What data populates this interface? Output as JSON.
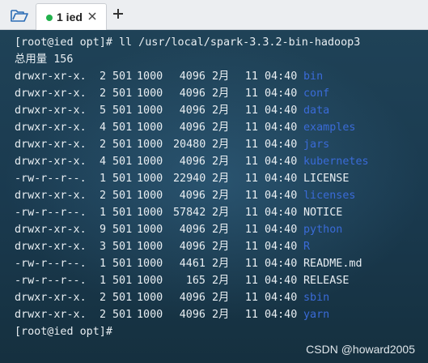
{
  "tabs": [
    {
      "label": "1 ied",
      "active": true,
      "status_color": "#22b14c"
    }
  ],
  "terminal": {
    "prompt_command": "[root@ied opt]# ll /usr/local/spark-3.3.2-bin-hadoop3",
    "total_line": "总用量 156",
    "entries": [
      {
        "perm": "drwxr-xr-x.",
        "links": "2",
        "user": "501",
        "group": "1000",
        "size": "4096",
        "month": "2月",
        "day": "11",
        "time": "04:40",
        "name": "bin",
        "dir": true
      },
      {
        "perm": "drwxr-xr-x.",
        "links": "2",
        "user": "501",
        "group": "1000",
        "size": "4096",
        "month": "2月",
        "day": "11",
        "time": "04:40",
        "name": "conf",
        "dir": true
      },
      {
        "perm": "drwxr-xr-x.",
        "links": "5",
        "user": "501",
        "group": "1000",
        "size": "4096",
        "month": "2月",
        "day": "11",
        "time": "04:40",
        "name": "data",
        "dir": true
      },
      {
        "perm": "drwxr-xr-x.",
        "links": "4",
        "user": "501",
        "group": "1000",
        "size": "4096",
        "month": "2月",
        "day": "11",
        "time": "04:40",
        "name": "examples",
        "dir": true
      },
      {
        "perm": "drwxr-xr-x.",
        "links": "2",
        "user": "501",
        "group": "1000",
        "size": "20480",
        "month": "2月",
        "day": "11",
        "time": "04:40",
        "name": "jars",
        "dir": true
      },
      {
        "perm": "drwxr-xr-x.",
        "links": "4",
        "user": "501",
        "group": "1000",
        "size": "4096",
        "month": "2月",
        "day": "11",
        "time": "04:40",
        "name": "kubernetes",
        "dir": true
      },
      {
        "perm": "-rw-r--r--.",
        "links": "1",
        "user": "501",
        "group": "1000",
        "size": "22940",
        "month": "2月",
        "day": "11",
        "time": "04:40",
        "name": "LICENSE",
        "dir": false
      },
      {
        "perm": "drwxr-xr-x.",
        "links": "2",
        "user": "501",
        "group": "1000",
        "size": "4096",
        "month": "2月",
        "day": "11",
        "time": "04:40",
        "name": "licenses",
        "dir": true
      },
      {
        "perm": "-rw-r--r--.",
        "links": "1",
        "user": "501",
        "group": "1000",
        "size": "57842",
        "month": "2月",
        "day": "11",
        "time": "04:40",
        "name": "NOTICE",
        "dir": false
      },
      {
        "perm": "drwxr-xr-x.",
        "links": "9",
        "user": "501",
        "group": "1000",
        "size": "4096",
        "month": "2月",
        "day": "11",
        "time": "04:40",
        "name": "python",
        "dir": true
      },
      {
        "perm": "drwxr-xr-x.",
        "links": "3",
        "user": "501",
        "group": "1000",
        "size": "4096",
        "month": "2月",
        "day": "11",
        "time": "04:40",
        "name": "R",
        "dir": true
      },
      {
        "perm": "-rw-r--r--.",
        "links": "1",
        "user": "501",
        "group": "1000",
        "size": "4461",
        "month": "2月",
        "day": "11",
        "time": "04:40",
        "name": "README.md",
        "dir": false
      },
      {
        "perm": "-rw-r--r--.",
        "links": "1",
        "user": "501",
        "group": "1000",
        "size": "165",
        "month": "2月",
        "day": "11",
        "time": "04:40",
        "name": "RELEASE",
        "dir": false
      },
      {
        "perm": "drwxr-xr-x.",
        "links": "2",
        "user": "501",
        "group": "1000",
        "size": "4096",
        "month": "2月",
        "day": "11",
        "time": "04:40",
        "name": "sbin",
        "dir": true
      },
      {
        "perm": "drwxr-xr-x.",
        "links": "2",
        "user": "501",
        "group": "1000",
        "size": "4096",
        "month": "2月",
        "day": "11",
        "time": "04:40",
        "name": "yarn",
        "dir": true
      }
    ],
    "final_prompt": "[root@ied opt]#"
  },
  "watermark": "CSDN @howard2005",
  "colors": {
    "directory": "#3a6bd8",
    "text": "#e8eef2",
    "background": "#1b3a4e"
  },
  "icons": {
    "folder": "folder-open-icon",
    "close": "close-icon",
    "add": "plus-icon"
  }
}
